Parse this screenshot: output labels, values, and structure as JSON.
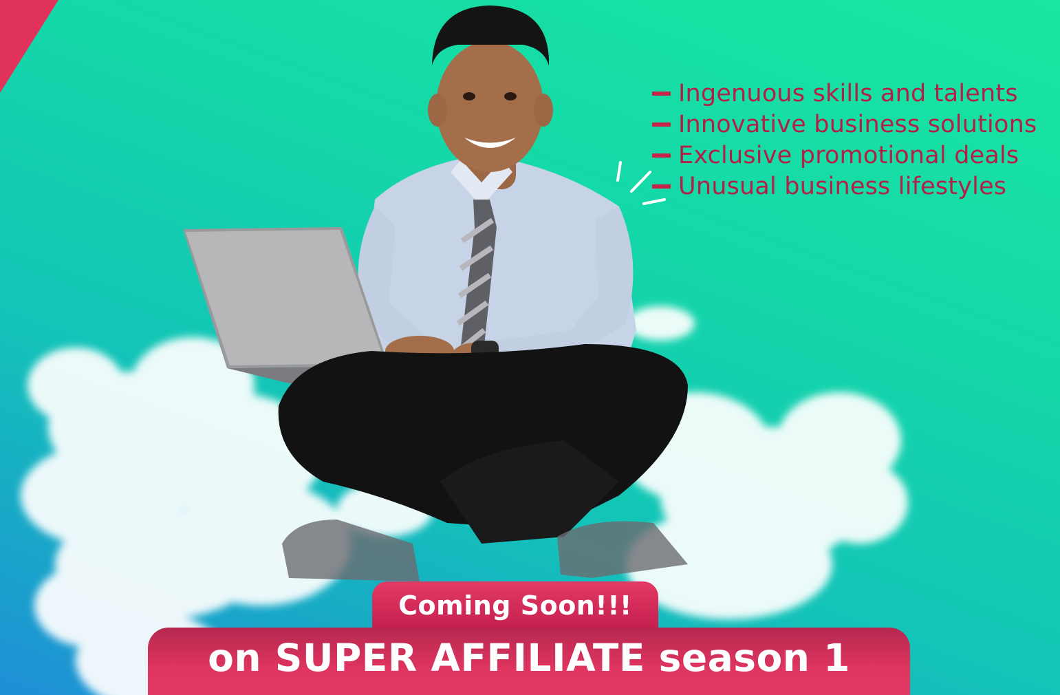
{
  "poster": {
    "colors": {
      "background_top": "#19e6a0",
      "background_bottom": "#1e8fd6",
      "accent": "#e0325a",
      "bullet_text": "#b41f48"
    },
    "features": [
      "Ingenuous skills and talents",
      "Innovative business solutions",
      "Exclusive promotional deals",
      "Unusual business lifestyles"
    ],
    "coming_soon_label": "Coming Soon!!!",
    "banner_label": "on SUPER AFFILIATE season 1"
  }
}
